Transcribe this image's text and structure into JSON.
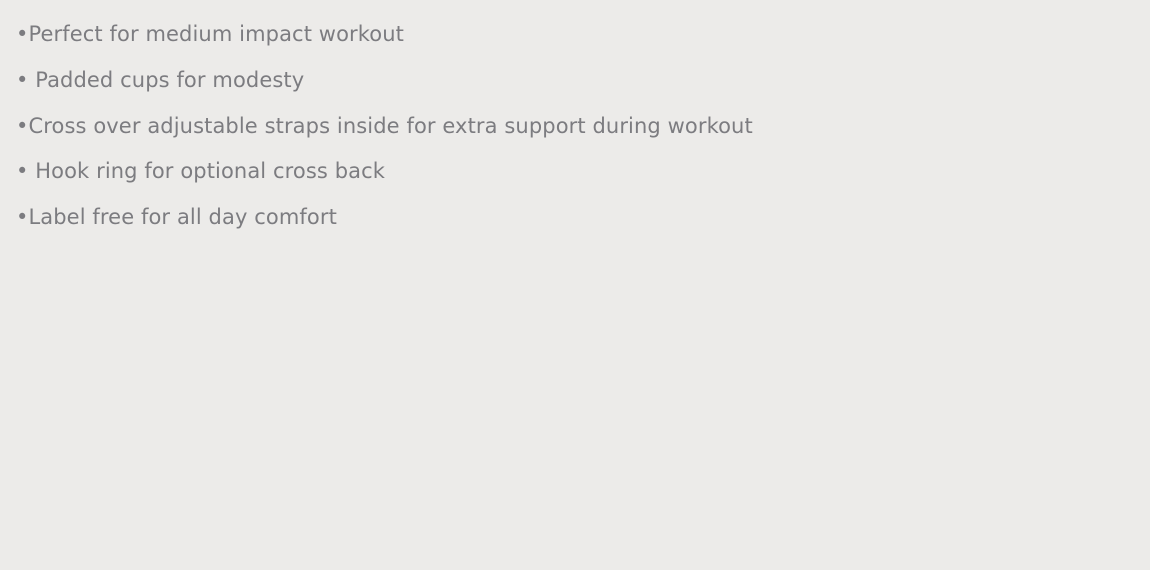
{
  "colors": {
    "background": "#ecebe9",
    "text": "#7c7c80"
  },
  "features": [
    "•Perfect for medium impact workout",
    "• Padded cups for modesty",
    "•Cross over adjustable straps inside for extra support during workout",
    "• Hook ring for optional cross back",
    "•Label free for all day comfort"
  ]
}
